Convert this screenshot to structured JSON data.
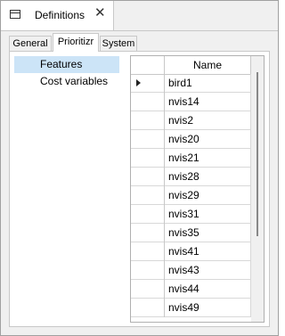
{
  "window": {
    "title": "Definitions",
    "close_glyph": "✕",
    "icon": "window-icon"
  },
  "tabs": [
    {
      "label": "General",
      "active": false
    },
    {
      "label": "Prioritizr",
      "active": true
    },
    {
      "label": "System",
      "active": false
    }
  ],
  "sidebar": {
    "items": [
      {
        "label": "Features",
        "selected": true
      },
      {
        "label": "Cost variables",
        "selected": false
      }
    ]
  },
  "grid": {
    "columns": [
      "Name"
    ],
    "current_row": 0,
    "rows": [
      "bird1",
      "nvis14",
      "nvis2",
      "nvis20",
      "nvis21",
      "nvis28",
      "nvis29",
      "nvis31",
      "nvis35",
      "nvis41",
      "nvis43",
      "nvis44",
      "nvis49"
    ]
  },
  "colors": {
    "selection": "#cce4f7",
    "border": "#c8c8c8",
    "background": "#f0f0f0"
  }
}
